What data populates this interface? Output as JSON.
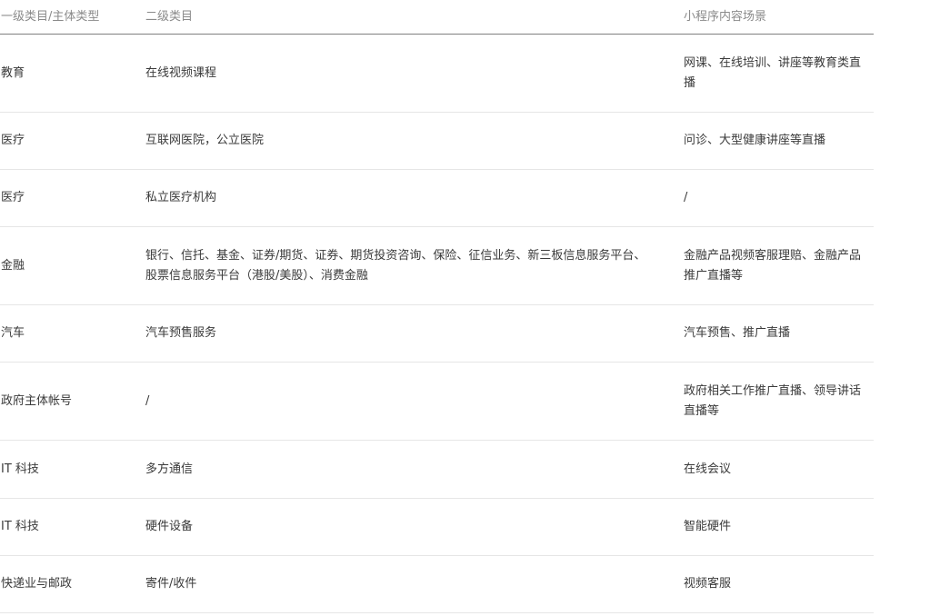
{
  "table": {
    "headers": {
      "col1": "一级类目/主体类型",
      "col2": "二级类目",
      "col3": "小程序内容场景"
    },
    "rows": [
      {
        "c1": "教育",
        "c2": "在线视频课程",
        "c3": "网课、在线培训、讲座等教育类直播"
      },
      {
        "c1": "医疗",
        "c2": "互联网医院，公立医院",
        "c3": "问诊、大型健康讲座等直播"
      },
      {
        "c1": "医疗",
        "c2": "私立医疗机构",
        "c3": "/"
      },
      {
        "c1": "金融",
        "c2": "银行、信托、基金、证券/期货、证券、期货投资咨询、保险、征信业务、新三板信息服务平台、股票信息服务平台（港股/美股）、消费金融",
        "c3": "金融产品视频客服理赔、金融产品推广直播等"
      },
      {
        "c1": "汽车",
        "c2": "汽车预售服务",
        "c3": "汽车预售、推广直播"
      },
      {
        "c1": "政府主体帐号",
        "c2": "/",
        "c3": "政府相关工作推广直播、领导讲话直播等"
      },
      {
        "c1": "IT 科技",
        "c2": "多方通信",
        "c3": "在线会议"
      },
      {
        "c1": "IT 科技",
        "c2": "硬件设备",
        "c3": "智能硬件"
      },
      {
        "c1": "快递业与邮政",
        "c2": "寄件/收件",
        "c3": "视频客服"
      }
    ]
  }
}
